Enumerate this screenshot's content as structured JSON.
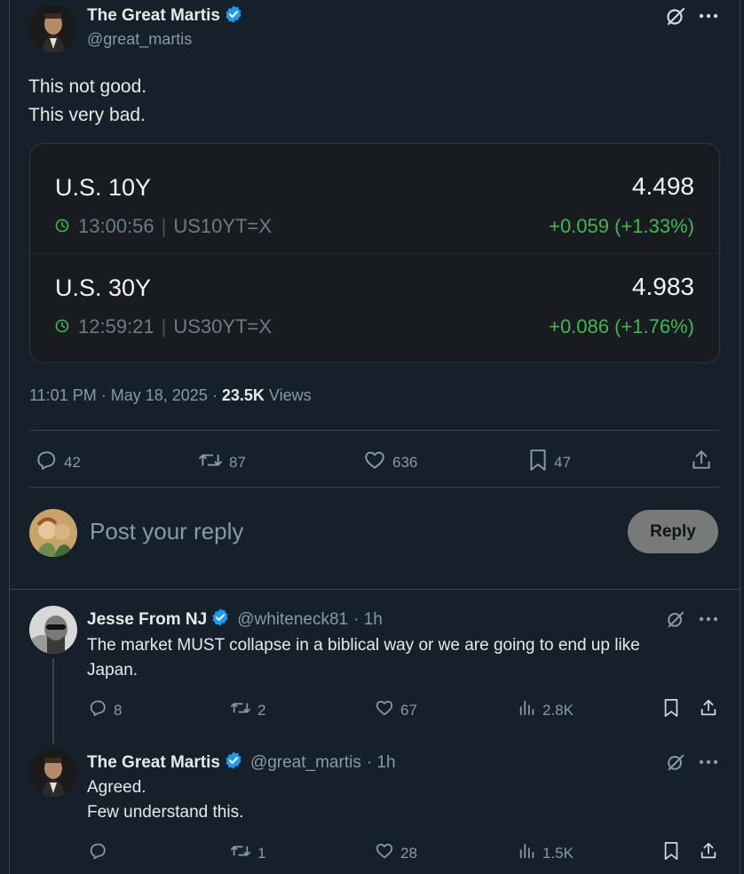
{
  "main_post": {
    "author": "The Great Martis",
    "handle": "@great_martis",
    "text_lines": [
      "This not good.",
      "This very bad."
    ],
    "card": {
      "rows": [
        {
          "title": "U.S. 10Y",
          "value": "4.498",
          "time": "13:00:56",
          "ticker": "US10YT=X",
          "change": "+0.059 (+1.33%)"
        },
        {
          "title": "U.S. 30Y",
          "value": "4.983",
          "time": "12:59:21",
          "ticker": "US30YT=X",
          "change": "+0.086 (+1.76%)"
        }
      ],
      "separator": "|"
    },
    "time": "11:01 PM",
    "date": "May 18, 2025",
    "dot": "·",
    "views_count": "23.5K",
    "views_label": "Views",
    "stats": {
      "replies": "42",
      "reposts": "87",
      "likes": "636",
      "bookmarks": "47"
    }
  },
  "compose": {
    "placeholder": "Post your reply",
    "button_label": "Reply"
  },
  "replies": [
    {
      "author": "Jesse From NJ",
      "handle": "@whiteneck81",
      "age": "· 1h",
      "text_lines": [
        "The market MUST collapse in a biblical way or we are going to end up like",
        "Japan."
      ],
      "stats": {
        "replies": "8",
        "reposts": "2",
        "likes": "67",
        "views": "2.8K"
      }
    },
    {
      "author": "The Great Martis",
      "handle": "@great_martis",
      "age": "· 1h",
      "text_lines": [
        "Agreed.",
        "Few understand this."
      ],
      "stats": {
        "replies": "",
        "reposts": "1",
        "likes": "28",
        "views": "1.5K"
      }
    }
  ],
  "icons": [
    "grok-icon",
    "more-icon",
    "verified-icon",
    "clock-icon",
    "reply-icon",
    "repost-icon",
    "like-icon",
    "bookmark-icon",
    "share-icon",
    "views-icon"
  ],
  "colors": {
    "background": "#15202b",
    "verified": "#1d9bf0",
    "positive": "#3fb950",
    "muted": "#8b98a5"
  }
}
